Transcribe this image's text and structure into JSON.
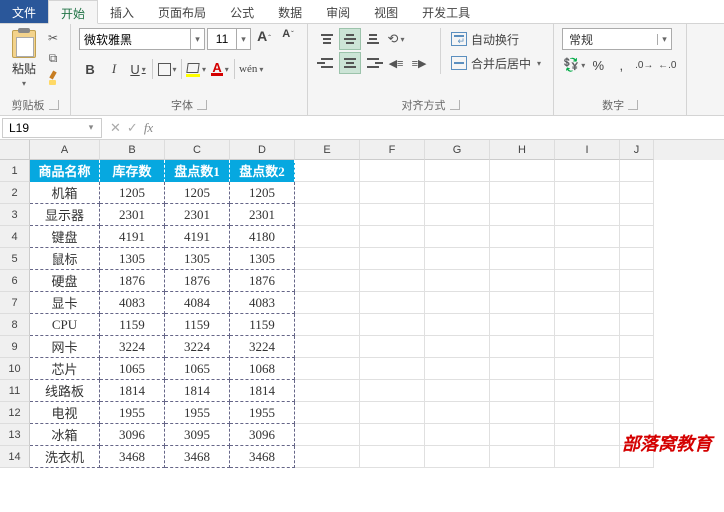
{
  "tabs": {
    "file": "文件",
    "items": [
      "开始",
      "插入",
      "页面布局",
      "公式",
      "数据",
      "审阅",
      "视图",
      "开发工具"
    ],
    "active_index": 0
  },
  "ribbon": {
    "clipboard": {
      "paste": "粘贴",
      "label": "剪贴板"
    },
    "font": {
      "name": "微软雅黑",
      "size": "11",
      "wen": "wén",
      "label": "字体"
    },
    "align": {
      "wrap": "自动换行",
      "merge": "合并后居中",
      "label": "对齐方式"
    },
    "number": {
      "format": "常规",
      "label": "数字"
    }
  },
  "formula_bar": {
    "cell_ref": "L19",
    "fx": "fx",
    "value": ""
  },
  "grid": {
    "col_letters": [
      "A",
      "B",
      "C",
      "D",
      "E",
      "F",
      "G",
      "H",
      "I",
      "J"
    ],
    "header_row": [
      "商品名称",
      "库存数",
      "盘点数1",
      "盘点数2"
    ],
    "rows": [
      [
        "机箱",
        "1205",
        "1205",
        "1205"
      ],
      [
        "显示器",
        "2301",
        "2301",
        "2301"
      ],
      [
        "键盘",
        "4191",
        "4191",
        "4180"
      ],
      [
        "鼠标",
        "1305",
        "1305",
        "1305"
      ],
      [
        "硬盘",
        "1876",
        "1876",
        "1876"
      ],
      [
        "显卡",
        "4083",
        "4084",
        "4083"
      ],
      [
        "CPU",
        "1159",
        "1159",
        "1159"
      ],
      [
        "网卡",
        "3224",
        "3224",
        "3224"
      ],
      [
        "芯片",
        "1065",
        "1065",
        "1068"
      ],
      [
        "线路板",
        "1814",
        "1814",
        "1814"
      ],
      [
        "电视",
        "1955",
        "1955",
        "1955"
      ],
      [
        "冰箱",
        "3096",
        "3095",
        "3096"
      ],
      [
        "洗衣机",
        "3468",
        "3468",
        "3468"
      ]
    ]
  },
  "watermark": "部落窝教育"
}
